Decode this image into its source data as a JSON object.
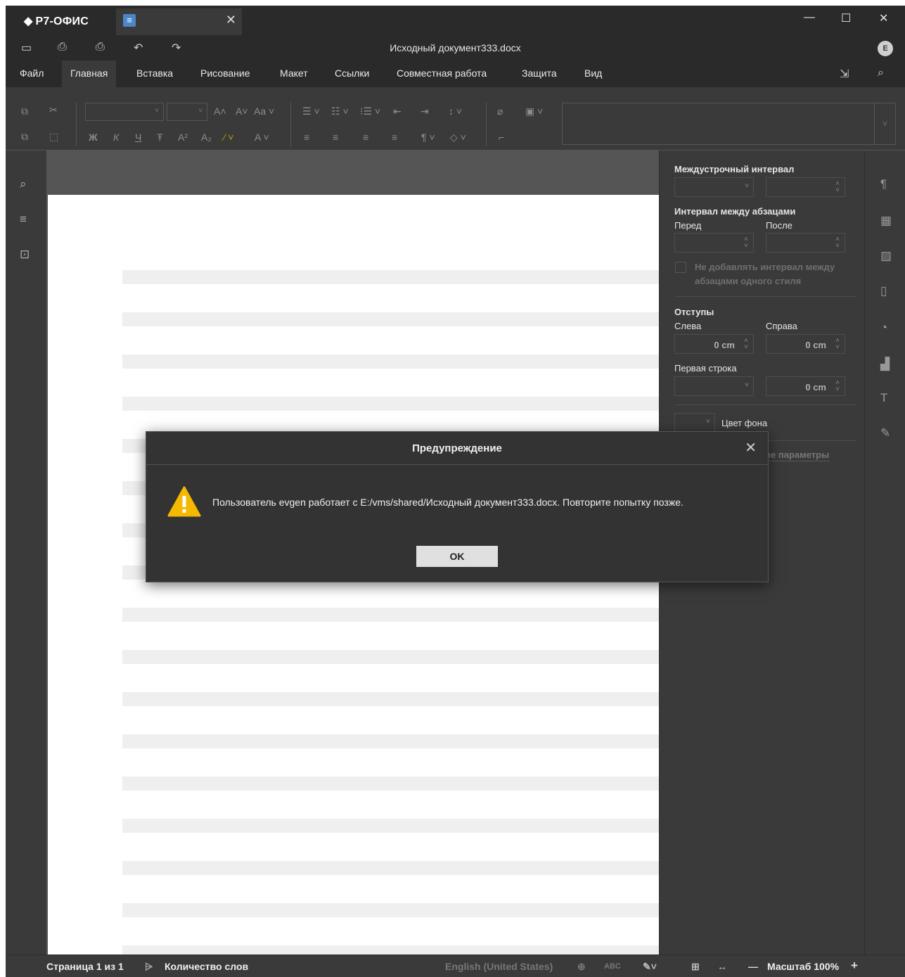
{
  "app": {
    "brand": "Р7-ОФИС",
    "doc_title": "Исходный документ333.docx",
    "avatar_letter": "E"
  },
  "window_controls": {
    "minimize": "—",
    "maximize": "☐",
    "close": "✕"
  },
  "tab": {
    "close": "✕"
  },
  "menu": {
    "tabs": [
      "Файл",
      "Главная",
      "Вставка",
      "Рисование",
      "Макет",
      "Ссылки",
      "Совместная работа",
      "Защита",
      "Вид"
    ],
    "active": "Главная"
  },
  "ribbon": {
    "row1": [
      "A˄",
      "A˅",
      "Aa ˅",
      "☰ ˅",
      "☷ ˅",
      "⁝☰ ˅",
      "⇤",
      "⇥",
      "↕ ˅",
      "⌀",
      "▣ ˅"
    ],
    "row2": [
      "Ж",
      "К",
      "Ч",
      "Ŧ",
      "A²",
      "A₂",
      "⁄ ˅",
      "A ˅",
      "≡",
      "≡",
      "≡",
      "≡",
      "¶ ˅",
      "◇ ˅",
      "⌐"
    ]
  },
  "right_panel": {
    "line_spacing_label": "Междустрочный интервал",
    "para_spacing_label": "Интервал между абзацами",
    "before_label": "Перед",
    "after_label": "После",
    "no_space_same_style": "Не добавлять интервал между абзацами одного стиля",
    "indents_label": "Отступы",
    "left_label": "Слева",
    "right_label": "Справа",
    "left_value": "0 cm",
    "right_value": "0 cm",
    "first_line_label": "Первая строка",
    "first_line_value": "0 cm",
    "bg_color_label": "Цвет фона",
    "advanced_link": "Дополнительные параметры",
    "advanced_link_visible": "ие параметры"
  },
  "status_bar": {
    "page": "Страница 1 из 1",
    "word_count": "Количество слов",
    "language": "English (United States)",
    "zoom": "Масштаб 100%"
  },
  "dialog": {
    "title": "Предупреждение",
    "message": "Пользователь evgen работает с E:/vms/shared/Исходный документ333.docx. Повторите попытку позже.",
    "ok": "OK"
  }
}
